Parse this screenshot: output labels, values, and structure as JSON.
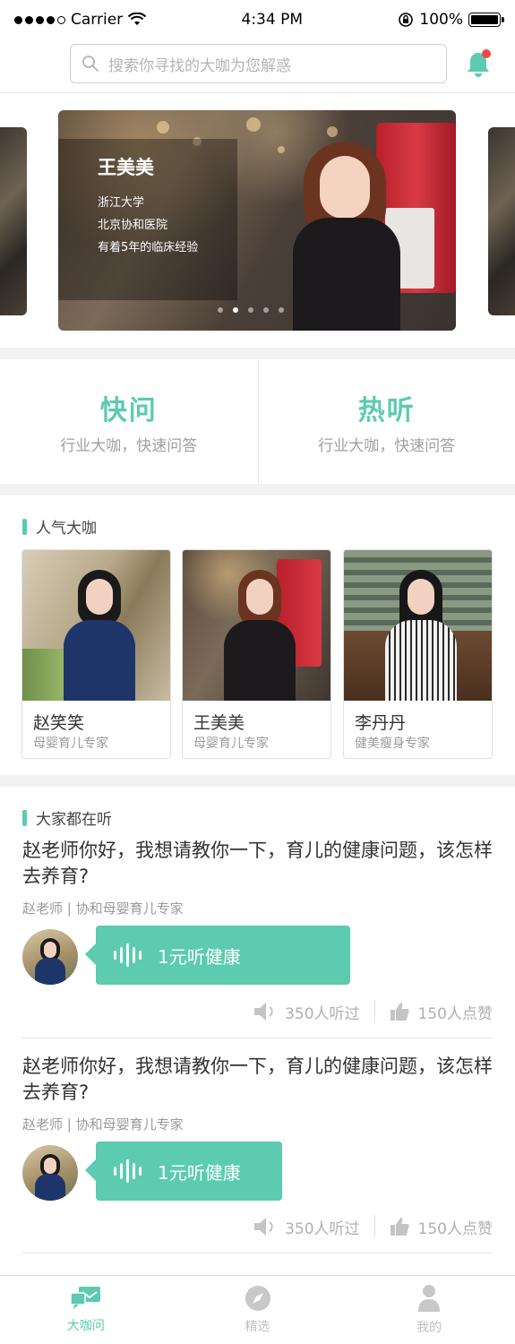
{
  "status_bar": {
    "carrier": "Carrier",
    "time": "4:34 PM",
    "battery": "100%"
  },
  "search": {
    "placeholder": "搜索你寻找的大咖为您解惑",
    "icon": "search-icon",
    "bell_icon": "bell-icon",
    "notification_dot_color": "#f04848"
  },
  "banner": {
    "name": "王美美",
    "lines": [
      "浙江大学",
      "北京协和医院",
      "有着5年的临床经验"
    ],
    "active_slide": 2,
    "slide_count": 5
  },
  "entries": [
    {
      "title": "快问",
      "subtitle": "行业大咖，快速问答"
    },
    {
      "title": "热听",
      "subtitle": "行业大咖，快速问答"
    }
  ],
  "popular": {
    "title": "人气大咖",
    "experts": [
      {
        "name": "赵笑笑",
        "role": "母婴育儿专家"
      },
      {
        "name": "王美美",
        "role": "母婴育儿专家"
      },
      {
        "name": "李丹丹",
        "role": "健美瘦身专家"
      }
    ]
  },
  "listening": {
    "title": "大家都在听",
    "items": [
      {
        "question": "赵老师你好，我想请教你一下，育儿的健康问题，该怎样去养育?",
        "author": "赵老师 | 协和母婴育儿专家",
        "voice_label": "1元听健康",
        "listens": "350人听过",
        "likes": "150人点赞"
      },
      {
        "question": "赵老师你好，我想请教你一下，育儿的健康问题，该怎样去养育?",
        "author": "赵老师 | 协和母婴育儿专家",
        "voice_label": "1元听健康",
        "listens": "350人听过",
        "likes": "150人点赞"
      }
    ]
  },
  "tabbar": {
    "items": [
      {
        "label": "大咖问",
        "icon": "chat-bubbles-icon",
        "active": true
      },
      {
        "label": "精选",
        "icon": "compass-icon",
        "active": false
      },
      {
        "label": "我的",
        "icon": "user-icon",
        "active": false
      }
    ]
  },
  "colors": {
    "accent": "#5ccbb0",
    "background": "#f2f2f2"
  }
}
